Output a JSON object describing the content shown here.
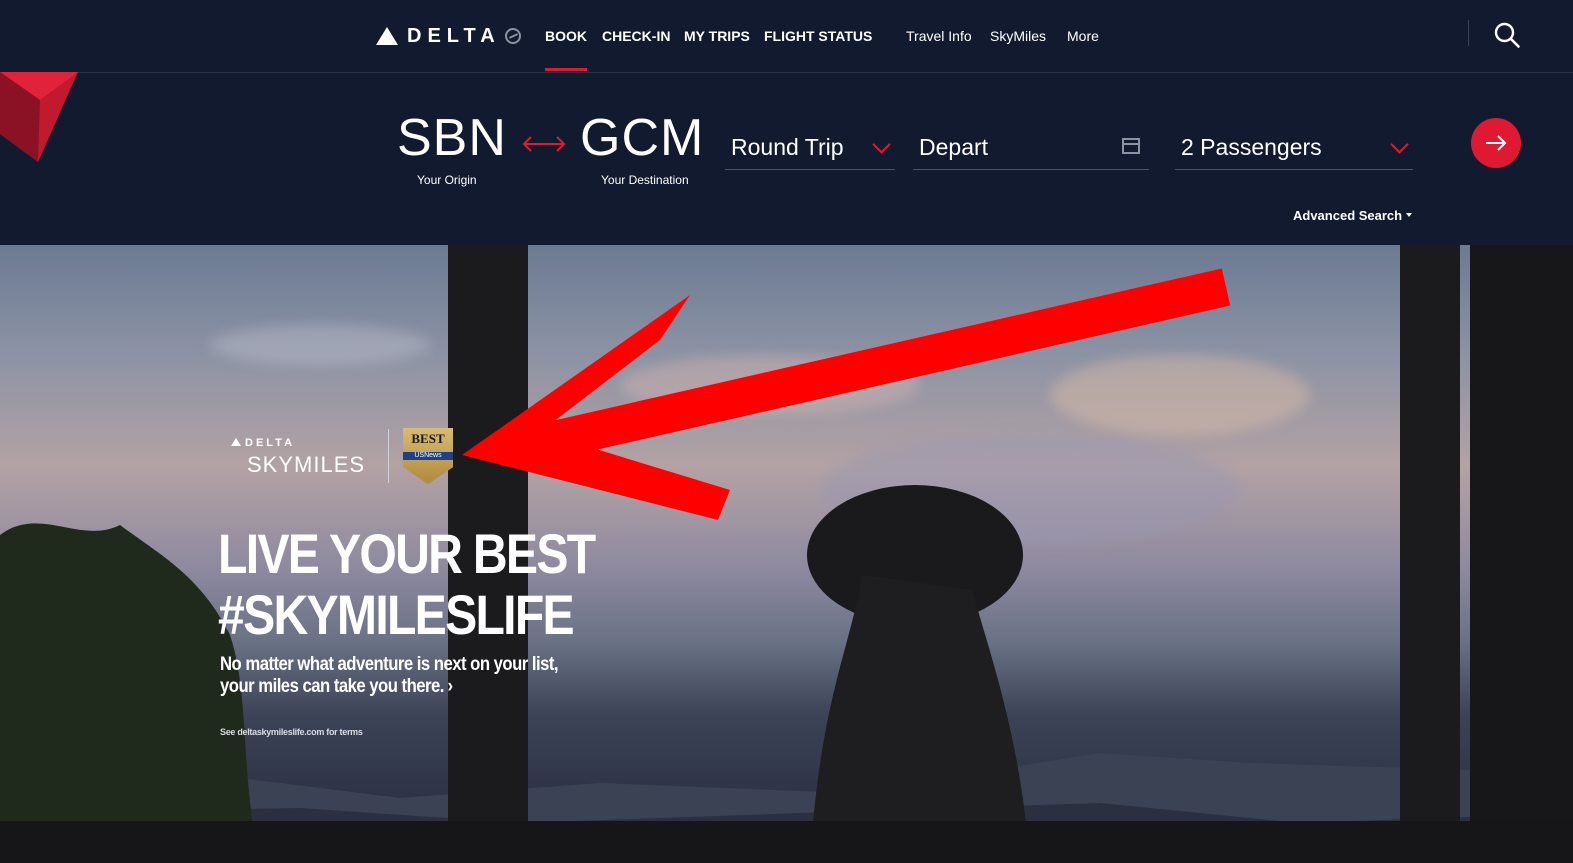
{
  "nav": {
    "logo_text": "DELTA",
    "primary": [
      "BOOK",
      "CHECK-IN",
      "MY TRIPS",
      "FLIGHT STATUS"
    ],
    "secondary": [
      "Travel Info",
      "SkyMiles",
      "More"
    ],
    "active_item": "BOOK",
    "search_icon": "search-icon"
  },
  "booking": {
    "origin_code": "SBN",
    "origin_label": "Your Origin",
    "destination_code": "GCM",
    "destination_label": "Your Destination",
    "trip_type": "Round Trip",
    "depart_placeholder": "Depart",
    "passengers": "2 Passengers",
    "advanced_search": "Advanced Search",
    "swap_icon": "swap-arrows-icon",
    "submit_icon": "arrow-right-icon"
  },
  "hero": {
    "brand_small": "DELTA",
    "brand_large": "SKYMILES",
    "badge_best": "BEST",
    "badge_org": "USNews",
    "headline_line1": "LIVE YOUR BEST",
    "headline_line2": "#SKYMILESLIFE",
    "sub_line1": "No matter what adventure is next on your list,",
    "sub_line2": "your miles can take you there.",
    "terms": "See deltaskymileslife.com for terms"
  },
  "colors": {
    "nav_bg": "#111a2e",
    "accent_red": "#e01933",
    "annotation_arrow": "#ff0000"
  }
}
